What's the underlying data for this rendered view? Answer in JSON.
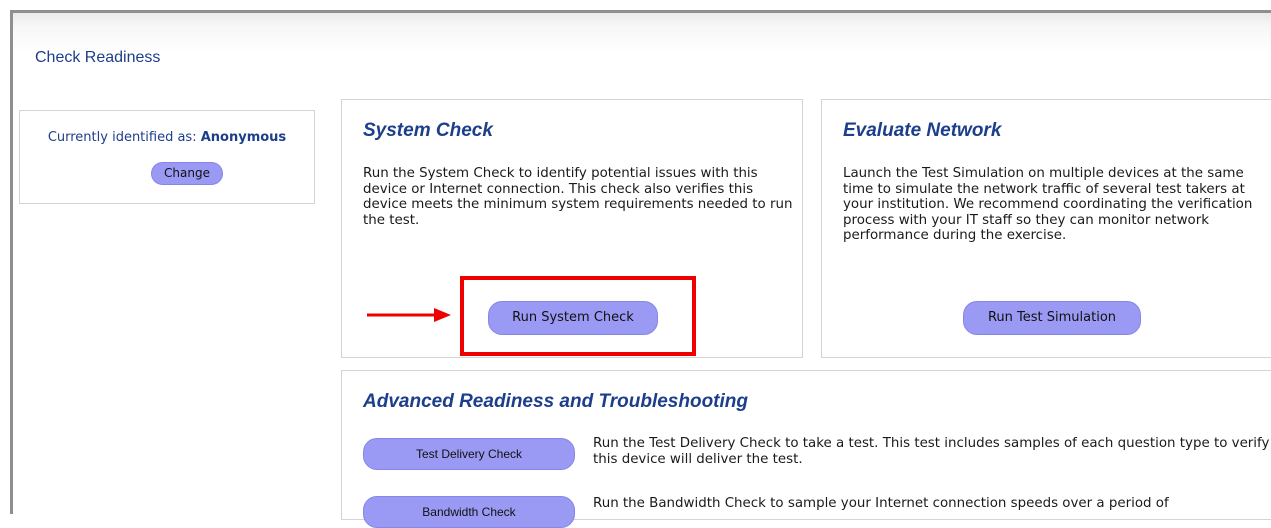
{
  "page": {
    "title": "Check Readiness"
  },
  "identity": {
    "label": "Currently identified as: ",
    "name": "Anonymous",
    "change_label": "Change"
  },
  "system_check": {
    "title": "System Check",
    "description": "Run the System Check to identify potential issues with this device or Internet connection. This check also verifies this device meets the minimum system requirements needed to run the test.",
    "button_label": "Run System Check"
  },
  "evaluate_network": {
    "title": "Evaluate Network",
    "description": "Launch the Test Simulation on multiple devices at the same time to simulate the network traffic of several test takers at your institution. We recommend coordinating the verification process with your IT staff so they can monitor network performance during the exercise.",
    "button_label": "Run Test Simulation"
  },
  "advanced": {
    "title": "Advanced Readiness and Troubleshooting",
    "items": [
      {
        "button_label": "Test Delivery Check",
        "description": "Run the Test Delivery Check to take a test. This test includes samples of each question type to verify this device will deliver the test."
      },
      {
        "button_label": "Bandwidth Check",
        "description": "Run the Bandwidth Check to sample your Internet connection speeds over a period of"
      }
    ]
  },
  "annotation": {
    "highlight_color": "#ee0000",
    "arrow_color": "#ee0000"
  },
  "colors": {
    "heading": "#1d3e8a",
    "button": "#9a9af5"
  }
}
